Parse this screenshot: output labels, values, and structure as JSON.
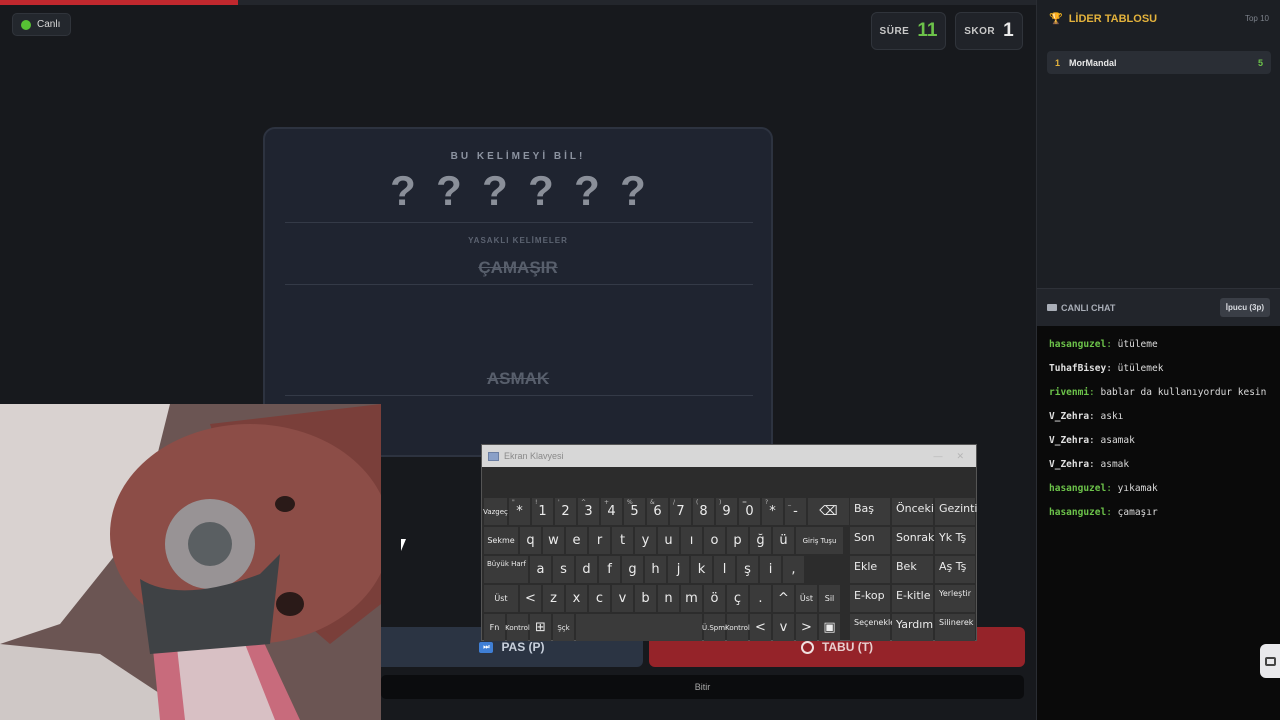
{
  "colors": {
    "accent_green": "#6cc24a",
    "accent_red": "#952329",
    "gold": "#e3b23c"
  },
  "timer_progress": 0.23,
  "status": {
    "live_label": "Canlı"
  },
  "stats": {
    "time_label": "SÜRE",
    "time_value": "11",
    "score_label": "SKOR",
    "score_value": "1"
  },
  "card": {
    "heading": "BU KELİMEYİ BİL!",
    "masked_word": [
      "?",
      "?",
      "?",
      "?",
      "?",
      "?"
    ],
    "forbidden_title": "YASAKLI KELİMELER",
    "forbidden_words": [
      "ÇAMAŞIR",
      "ASMAK"
    ]
  },
  "actions": {
    "pass_label": "PAS (P)",
    "taboo_label": "TABU (T)",
    "finish_label": "Bitir"
  },
  "keyboard": {
    "title": "Ekran Klavyesi",
    "row1": [
      {
        "m": "Vazgeç",
        "s": ""
      },
      {
        "m": "*",
        "s": "\""
      },
      {
        "m": "1",
        "s": "!"
      },
      {
        "m": "2",
        "s": "'"
      },
      {
        "m": "3",
        "s": "^"
      },
      {
        "m": "4",
        "s": "+"
      },
      {
        "m": "5",
        "s": "%"
      },
      {
        "m": "6",
        "s": "&"
      },
      {
        "m": "7",
        "s": "/"
      },
      {
        "m": "8",
        "s": "("
      },
      {
        "m": "9",
        "s": ")"
      },
      {
        "m": "0",
        "s": "="
      },
      {
        "m": "*",
        "s": "?"
      },
      {
        "m": "-",
        "s": "_"
      },
      {
        "m": "⌫",
        "s": ""
      }
    ],
    "row2": [
      "Sekme",
      "q",
      "w",
      "e",
      "r",
      "t",
      "y",
      "u",
      "ı",
      "o",
      "p",
      "ğ",
      "ü",
      "Giriş Tuşu"
    ],
    "row3": [
      "Büyük Harf",
      "a",
      "s",
      "d",
      "f",
      "g",
      "h",
      "j",
      "k",
      "l",
      "ş",
      "i",
      ","
    ],
    "row4": [
      "Üst",
      "<",
      "z",
      "x",
      "c",
      "v",
      "b",
      "n",
      "m",
      "ö",
      "ç",
      ".",
      "^",
      "Üst",
      "Sil"
    ],
    "row5": [
      "Fn",
      "Kontrol",
      "⊞",
      "Şçk",
      "",
      "Ü.Spmi",
      "Kontrol",
      "<",
      "v",
      ">",
      "▣"
    ],
    "nav": [
      [
        "Baş",
        "Önceki",
        "Gezinti"
      ],
      [
        "Son",
        "Sonraki",
        "Yk Tş"
      ],
      [
        "Ekle",
        "Bek",
        "Aş Tş"
      ],
      [
        "E-kop",
        "E-kitle",
        "Yerleştir"
      ],
      [
        "Seçenekler",
        "Yardım",
        "Silinerek"
      ]
    ]
  },
  "leaderboard": {
    "title": "LİDER TABLOSU",
    "subtitle": "Top 10",
    "rows": [
      {
        "rank": "1",
        "name": "MorMandal",
        "score": "5"
      }
    ]
  },
  "chat": {
    "title": "CANLI CHAT",
    "hint_button": "İpucu (3p)",
    "messages": [
      {
        "user": "hasanguzel",
        "text": "ütüleme",
        "color": "#6cc24a"
      },
      {
        "user": "TuhafBisey",
        "text": "ütülemek",
        "color": "#e0e0e0"
      },
      {
        "user": "rivenmi",
        "text": "bablar da kullanıyordur kesin",
        "color": "#6cc24a"
      },
      {
        "user": "V_Zehra",
        "text": "askı",
        "color": "#e0e0e0"
      },
      {
        "user": "V_Zehra",
        "text": "asamak",
        "color": "#e0e0e0"
      },
      {
        "user": "V_Zehra",
        "text": "asmak",
        "color": "#e0e0e0"
      },
      {
        "user": "hasanguzel",
        "text": "yıkamak",
        "color": "#6cc24a"
      },
      {
        "user": "hasanguzel",
        "text": "çamaşır",
        "color": "#6cc24a"
      }
    ]
  }
}
